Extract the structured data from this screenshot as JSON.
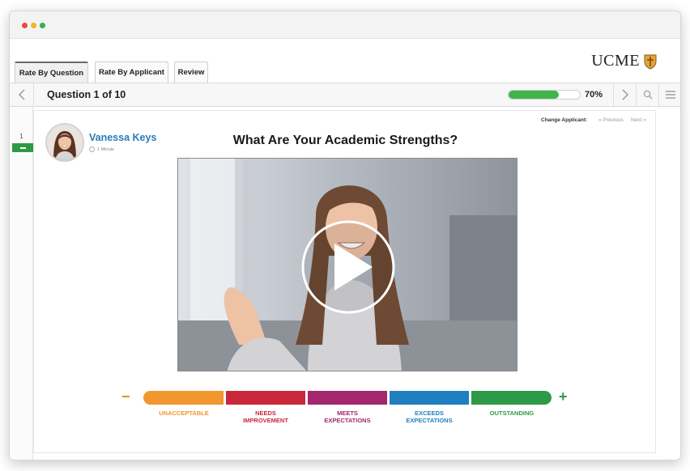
{
  "tabs": [
    {
      "label": "Rate By Question"
    },
    {
      "label": "Rate By Applicant"
    },
    {
      "label": "Review"
    }
  ],
  "logo": {
    "text": "UCME"
  },
  "nav": {
    "question_title": "Question 1 of 10",
    "progress_percent": 70,
    "progress_label": "70%"
  },
  "rail": {
    "number": "1"
  },
  "applicant": {
    "name": "Vanessa Keys",
    "duration": "1 Minute",
    "change_label": "Change Applicant:",
    "previous_label": "« Previous",
    "next_label": "Next »"
  },
  "question": {
    "heading": "What Are Your Academic Strengths?"
  },
  "rating": {
    "minus_symbol": "−",
    "plus_symbol": "+",
    "levels": [
      {
        "label": "UNACCEPTABLE",
        "color": "#f2962e"
      },
      {
        "label": "NEEDS\nIMPROVEMENT",
        "color": "#c8283a"
      },
      {
        "label": "MEETS\nEXPECTATIONS",
        "color": "#a3266e"
      },
      {
        "label": "EXCEEDS\nEXPECTATIONS",
        "color": "#1f7fc1"
      },
      {
        "label": "OUTSTANDING",
        "color": "#2e9a45"
      }
    ]
  },
  "colors": {
    "accent_green": "#3fb54b",
    "name_blue": "#2a7ab8"
  }
}
